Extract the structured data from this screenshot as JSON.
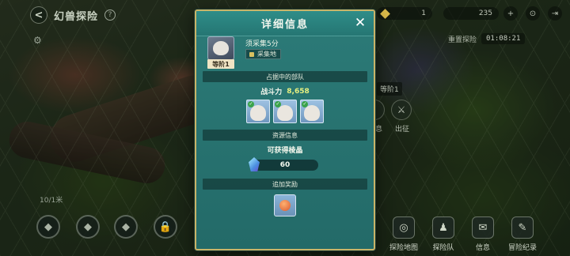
{
  "topbar": {
    "back_glyph": "<",
    "title": "幻兽探险",
    "help_glyph": "?",
    "resource_a": "1",
    "resource_b": "235",
    "add_glyph": "+",
    "settings_glyph": "⊙",
    "exit_glyph": "⇥"
  },
  "side": {
    "redo_label": "重置探险",
    "timer": "01:08:21",
    "level_chip": "等阶1",
    "info_label": "息",
    "depart_label": "出征",
    "distance": "10/1米"
  },
  "bottom_nav": [
    {
      "label": "探险地图",
      "icon": "map-icon"
    },
    {
      "label": "探险队",
      "icon": "team-icon"
    },
    {
      "label": "信息",
      "icon": "info-icon"
    },
    {
      "label": "冒险纪录",
      "icon": "record-icon"
    }
  ],
  "modal": {
    "title": "详细信息",
    "close_glyph": "✕",
    "level_tag": "等阶1",
    "requirement": "须采集5分",
    "gather_tag": "采集地",
    "occupying_header": "占据中的部队",
    "power_label": "战斗力",
    "power_value": "8,658",
    "troops": [
      {
        "check": "✓"
      },
      {
        "check": "✓"
      },
      {
        "check": "✓"
      }
    ],
    "resource_header": "资源信息",
    "obtainable_label": "可获得棱晶",
    "crystal_value": "60",
    "bonus_header": "追加奖励"
  }
}
